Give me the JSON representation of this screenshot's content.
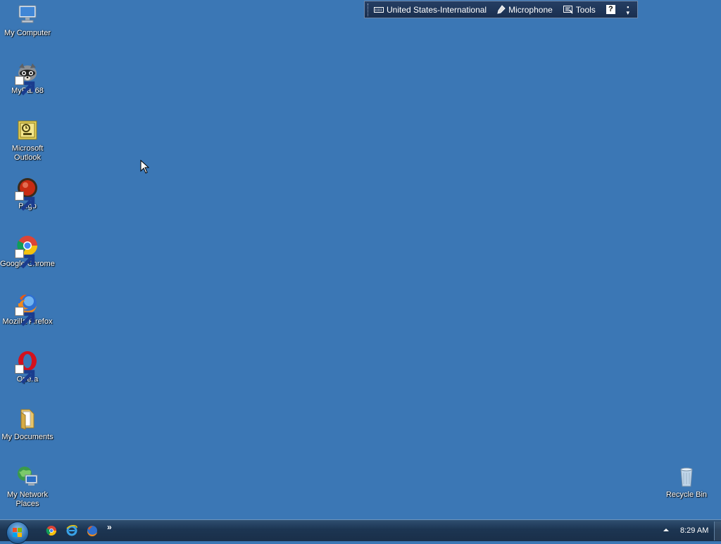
{
  "desktop": {
    "icons": [
      {
        "label": "My Computer",
        "icon": "computer-icon"
      },
      {
        "label": "MyPal 68",
        "icon": "mypal-icon"
      },
      {
        "label": "Microsoft Outlook",
        "icon": "outlook-icon"
      },
      {
        "label": "Pego",
        "icon": "pego-icon"
      },
      {
        "label": "Google Chrome",
        "icon": "chrome-icon"
      },
      {
        "label": "Mozilla Firefox",
        "icon": "firefox-icon"
      },
      {
        "label": "Opera",
        "icon": "opera-icon"
      },
      {
        "label": "My Documents",
        "icon": "folder-icon"
      },
      {
        "label": "My Network Places",
        "icon": "network-icon"
      },
      {
        "label": "Recycle Bin",
        "icon": "recycle-bin-icon"
      }
    ]
  },
  "langbar": {
    "language": "United States-International",
    "microphone": "Microphone",
    "tools": "Tools",
    "help": "?"
  },
  "taskbar": {
    "quicklaunch": [
      "chrome-icon",
      "ie-icon",
      "firefox-icon"
    ],
    "overflow": "»",
    "clock": "8:29 AM"
  },
  "colors": {
    "desktop": "#3b77b5",
    "taskbar": "#1c3552"
  }
}
